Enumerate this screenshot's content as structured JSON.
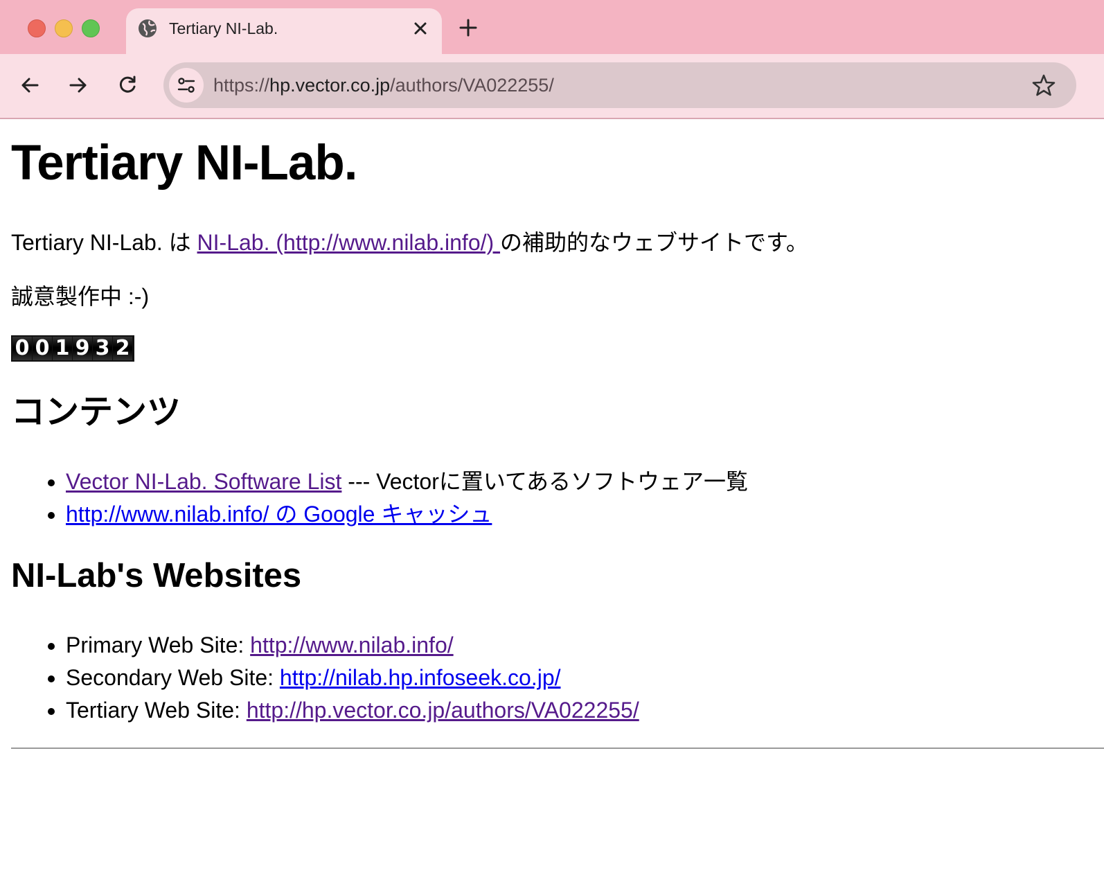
{
  "browser": {
    "tab_title": "Tertiary NI-Lab.",
    "url_scheme": "https://",
    "url_host": "hp.vector.co.jp",
    "url_path": "/authors/VA022255/",
    "icons": [
      "globe-icon",
      "close-icon",
      "plus-icon",
      "arrow-left-icon",
      "arrow-right-icon",
      "reload-icon",
      "tune-icon",
      "star-icon"
    ]
  },
  "page": {
    "title": "Tertiary NI-Lab.",
    "intro_prefix": "Tertiary NI-Lab. は ",
    "intro_link": "NI-Lab. (http://www.nilab.info/) ",
    "intro_suffix": "の補助的なウェブサイトです。",
    "wip": "誠意製作中 :-)",
    "counter_digits": [
      "0",
      "0",
      "1",
      "9",
      "3",
      "2"
    ],
    "contents_heading": "コンテンツ",
    "contents": [
      {
        "link": "Vector NI-Lab. Software List",
        "text": " --- Vectorに置いてあるソフトウェア一覧"
      },
      {
        "link": "http://www.nilab.info/ の Google キャッシュ",
        "text": ""
      }
    ],
    "sites_heading": "NI-Lab's Websites",
    "sites": [
      {
        "label": "Primary Web Site: ",
        "link": "http://www.nilab.info/"
      },
      {
        "label": "Secondary Web Site: ",
        "link": "http://nilab.hp.infoseek.co.jp/"
      },
      {
        "label": "Tertiary Web Site: ",
        "link": "http://hp.vector.co.jp/authors/VA022255/"
      }
    ]
  },
  "colors": {
    "chrome_bg": "#f4b4c2",
    "toolbar_bg": "#fadfe5",
    "visited_link": "#551a8b",
    "unvisited_link": "#0000ee"
  }
}
